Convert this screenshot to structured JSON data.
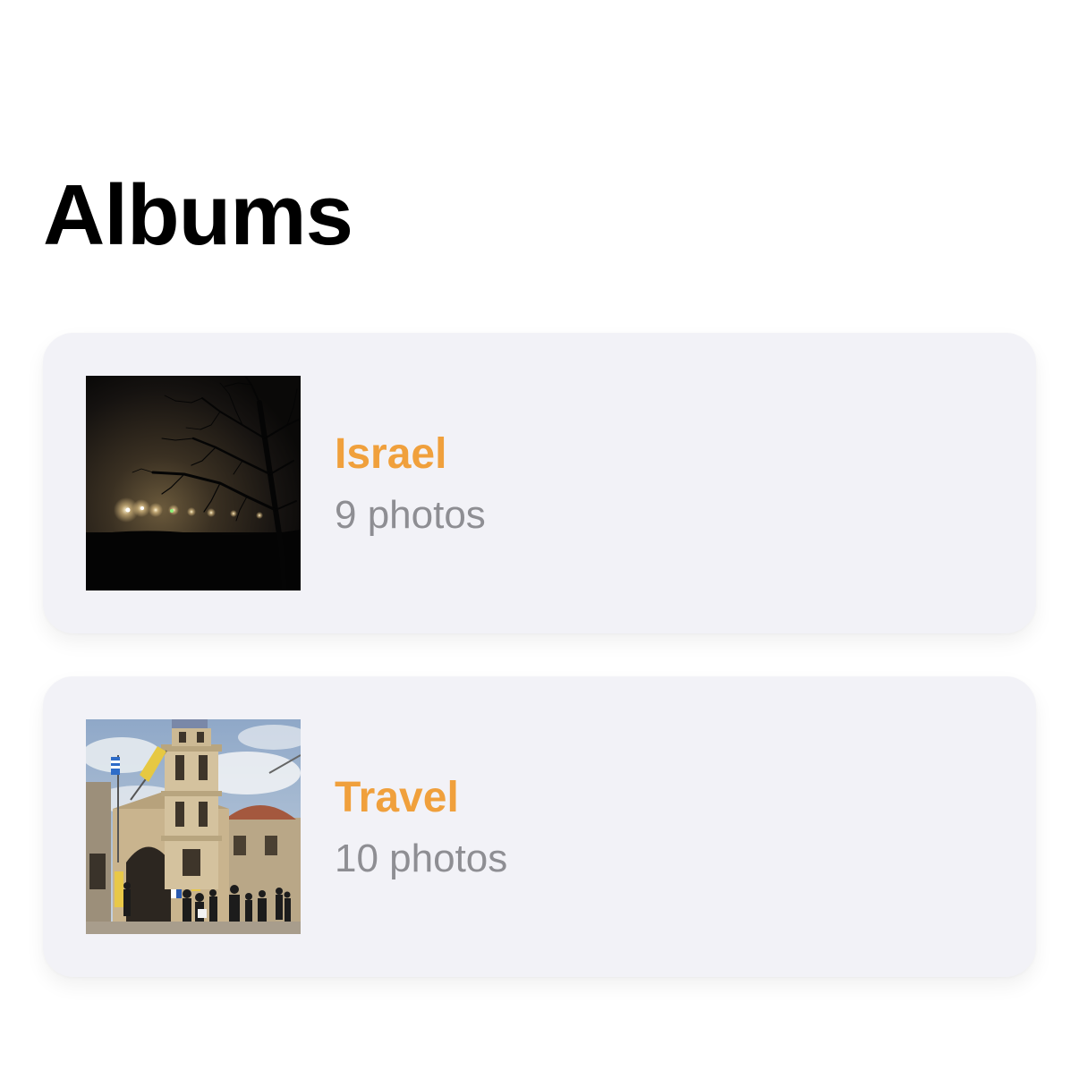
{
  "header": {
    "title": "Albums"
  },
  "theme": {
    "accent": "#f0a03c",
    "secondary_text": "#8e8e93",
    "card_background": "#f2f2f7"
  },
  "albums": [
    {
      "name": "Israel",
      "count": "9 photos",
      "cover": "night-fog-tree-photo"
    },
    {
      "name": "Travel",
      "count": "10 photos",
      "cover": "stone-church-tower-photo"
    }
  ]
}
